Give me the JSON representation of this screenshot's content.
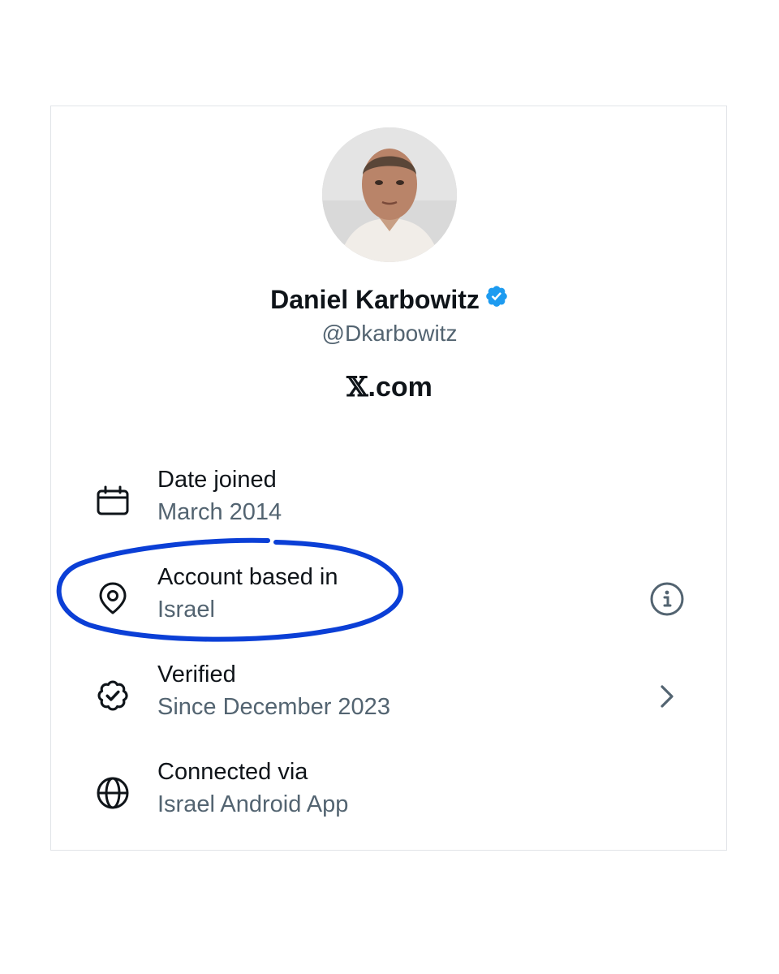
{
  "profile": {
    "name": "Daniel Karbowitz",
    "handle": "@Dkarbowitz",
    "verified_badge_icon": "verified-badge-icon",
    "site_x": "𝕏",
    "site_suffix": ".com"
  },
  "colors": {
    "verified_blue": "#1d9bf0",
    "annotation_blue": "#0b3fd6",
    "text_primary": "#0f1419",
    "text_secondary": "#536471"
  },
  "details": [
    {
      "icon": "calendar-icon",
      "title": "Date joined",
      "value": "March 2014"
    },
    {
      "icon": "location-pin-icon",
      "title": "Account based in",
      "value": "Israel",
      "right_icon": "info-icon"
    },
    {
      "icon": "verified-seal-icon",
      "title": "Verified",
      "value": "Since December 2023",
      "right_icon": "chevron-right-icon"
    },
    {
      "icon": "globe-icon",
      "title": "Connected via",
      "value": "Israel Android App"
    }
  ]
}
